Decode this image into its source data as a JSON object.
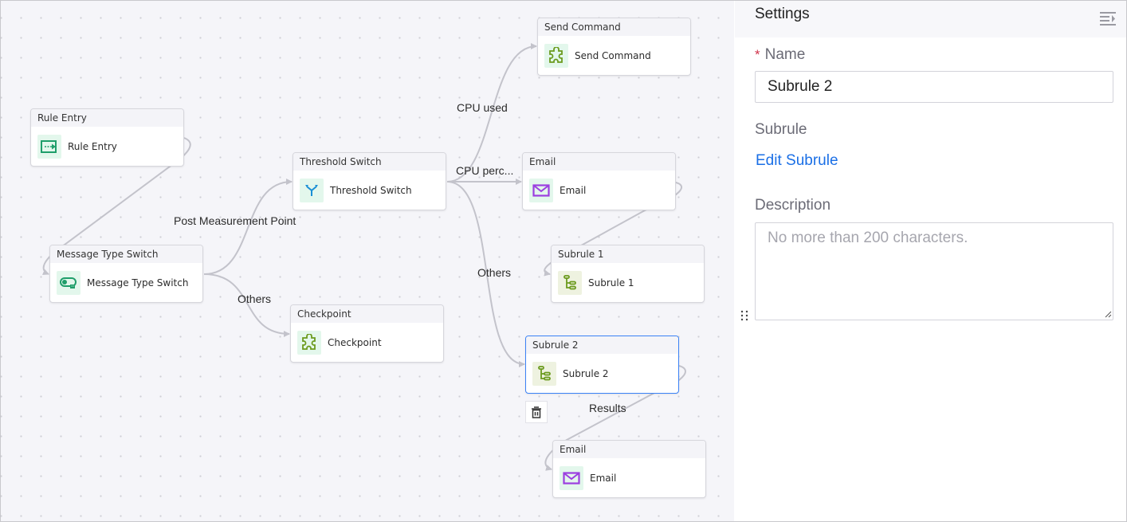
{
  "canvas": {
    "nodes": [
      {
        "id": "rule-entry",
        "header": "Rule Entry",
        "title": "Rule Entry",
        "icon": "rule-entry-icon"
      },
      {
        "id": "message-type-switch",
        "header": "Message Type Switch",
        "title": "Message Type Switch",
        "icon": "toggle-switch-icon"
      },
      {
        "id": "threshold-switch",
        "header": "Threshold Switch",
        "title": "Threshold Switch",
        "icon": "fork-icon"
      },
      {
        "id": "checkpoint",
        "header": "Checkpoint",
        "title": "Checkpoint",
        "icon": "puzzle-icon"
      },
      {
        "id": "send-command",
        "header": "Send Command",
        "title": "Send Command",
        "icon": "puzzle-icon"
      },
      {
        "id": "email-1",
        "header": "Email",
        "title": "Email",
        "icon": "envelope-icon"
      },
      {
        "id": "subrule-1",
        "header": "Subrule 1",
        "title": "Subrule 1",
        "icon": "tree-icon"
      },
      {
        "id": "subrule-2",
        "header": "Subrule 2",
        "title": "Subrule 2",
        "icon": "tree-icon",
        "selected": true
      },
      {
        "id": "email-2",
        "header": "Email",
        "title": "Email",
        "icon": "envelope-icon"
      }
    ],
    "edge_labels": {
      "post_measurement_point": "Post Measurement Point",
      "others_1": "Others",
      "cpu_used": "CPU used",
      "cpu_percent": "CPU perc...",
      "others_2": "Others",
      "results": "Results"
    },
    "delete_icon": "trash-icon",
    "colors": {
      "edge": "#c3c3cb",
      "selected_border": "#3b82f6",
      "icon_green": "#1f9e6a",
      "icon_blue": "#1a8fd6",
      "icon_olive": "#6b9a1d",
      "icon_purple": "#9b3fe0"
    }
  },
  "settings": {
    "title": "Settings",
    "collapse_icon": "collapse-panel-icon",
    "name_label": "Name",
    "name_required": "*",
    "name_value": "Subrule 2",
    "subrule_label": "Subrule",
    "edit_subrule_link": "Edit Subrule",
    "description_label": "Description",
    "description_placeholder": "No more than 200 characters.",
    "description_value": "",
    "link_color": "#1a6fe6",
    "required_color": "#d0344b"
  }
}
